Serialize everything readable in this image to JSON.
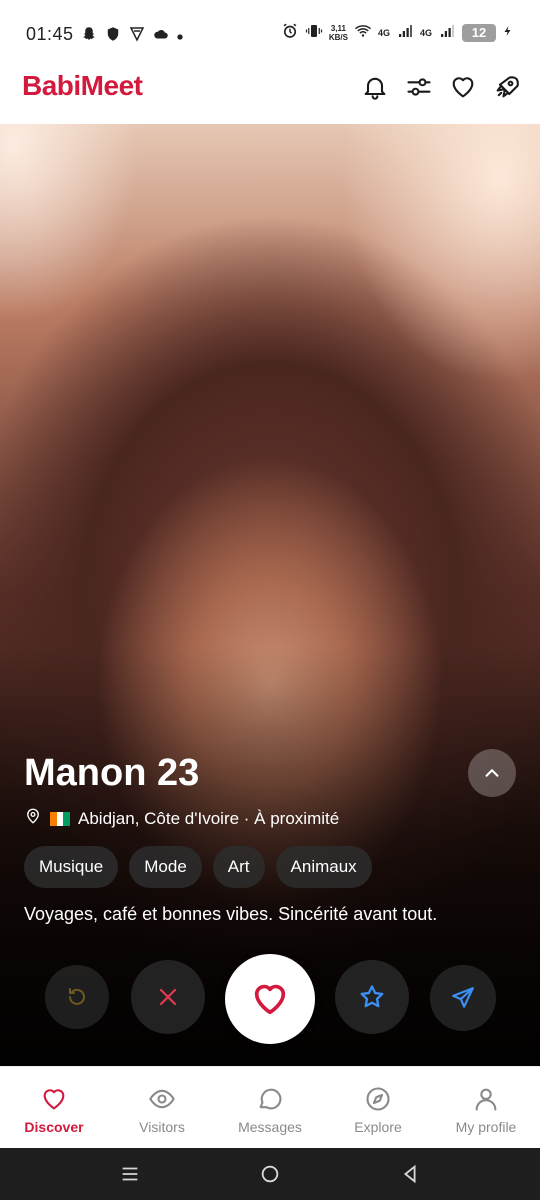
{
  "status_bar": {
    "time": "01:45",
    "speed_value": "3,11",
    "speed_unit": "KB/S",
    "net_1": "4G",
    "net_2": "4G",
    "battery": "12",
    "left_icons": [
      "snapchat-icon",
      "shield-icon",
      "vpn-icon",
      "cloud-icon",
      "dot-icon"
    ],
    "right_icons": [
      "alarm-icon",
      "vibrate-icon",
      "wifi-icon",
      "signal-icon",
      "signal-icon",
      "battery-icon",
      "charging-icon"
    ]
  },
  "header": {
    "brand": "BabiMeet",
    "brand_color": "#d3193d",
    "icons": [
      "bell-icon",
      "sliders-icon",
      "heart-icon",
      "rocket-icon"
    ]
  },
  "profile": {
    "name_age": "Manon 23",
    "location": "Abidjan, Côte d'Ivoire · À proximité",
    "flag": "cote-divoire-flag",
    "tags": [
      "Musique",
      "Mode",
      "Art",
      "Animaux"
    ],
    "bio": "Voyages, café et bonnes vibes. Sincérité avant tout."
  },
  "actions": [
    "undo-icon",
    "close-icon",
    "heart-icon",
    "star-icon",
    "send-icon"
  ],
  "bottom_nav": {
    "items": [
      {
        "label": "Discover",
        "icon": "heart-icon",
        "active": true
      },
      {
        "label": "Visitors",
        "icon": "eye-icon",
        "active": false
      },
      {
        "label": "Messages",
        "icon": "chat-bubble-icon",
        "active": false
      },
      {
        "label": "Explore",
        "icon": "compass-icon",
        "active": false
      },
      {
        "label": "My profile",
        "icon": "user-icon",
        "active": false
      }
    ],
    "active_color": "#d3193d"
  }
}
